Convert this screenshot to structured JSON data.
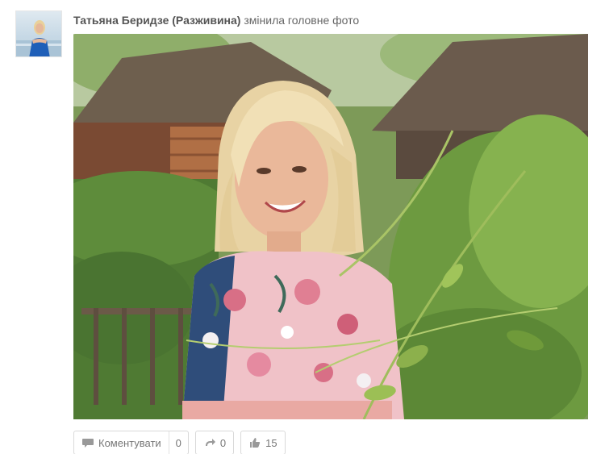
{
  "post": {
    "author": "Татьяна Беридзе (Разживина)",
    "action": "змінила головне фото"
  },
  "actions": {
    "comment_label": "Коментувати",
    "comment_count": "0",
    "reshare_count": "0",
    "like_count": "15"
  },
  "icons": {
    "comment": "speech-bubble-icon",
    "reshare": "reshare-arrow-icon",
    "like": "thumbs-up-icon"
  },
  "colors": {
    "author_text": "#555555",
    "button_border": "#d9d9d9",
    "icon_gray": "#999999"
  }
}
